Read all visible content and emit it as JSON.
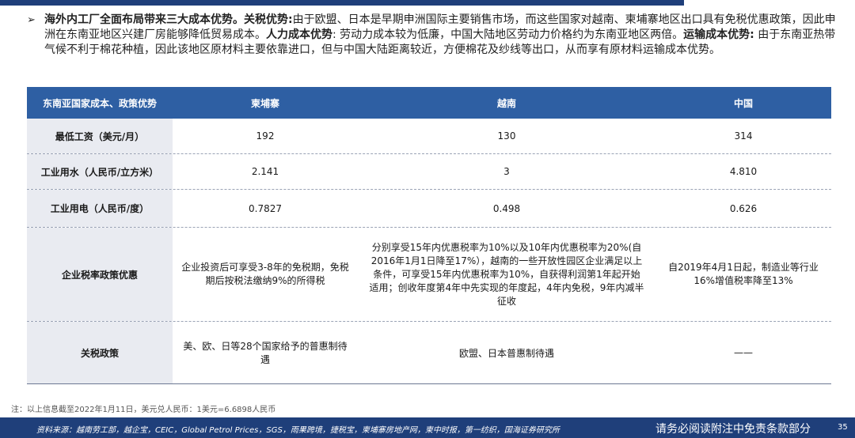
{
  "intro": {
    "bullet": "➢",
    "segments": [
      {
        "text": "海外内工厂全面布局带来三大成本优势。关税优势:",
        "bold": true
      },
      {
        "text": "由于欧盟、日本是早期申洲国际主要销售市场，而这些国家对越南、柬埔寨地区出口具有免税优惠政策，因此申洲在东南亚地区兴建厂房能够降低贸易成本。",
        "bold": false
      },
      {
        "text": "人力成本优势",
        "bold": true
      },
      {
        "text": ": 劳动力成本较为低廉，中国大陆地区劳动力价格约为东南亚地区两倍。",
        "bold": false
      },
      {
        "text": "运输成本优势:",
        "bold": true
      },
      {
        "text": " 由于东南亚热带气候不利于棉花种植，因此该地区原材料主要依靠进口，但与中国大陆距离较近，方便棉花及纱线等出口，从而享有原材料运输成本优势。",
        "bold": false
      }
    ]
  },
  "table": {
    "headers": [
      "东南亚国家成本、政策优势",
      "柬埔寨",
      "越南",
      "中国"
    ],
    "rows": [
      {
        "label": "最低工资（美元/月）",
        "cells": [
          "192",
          "130",
          "314"
        ]
      },
      {
        "label": "工业用水（人民币/立方米）",
        "cells": [
          "2.141",
          "3",
          "4.810"
        ]
      },
      {
        "label": "工业用电（人民币/度）",
        "cells": [
          "0.7827",
          "0.498",
          "0.626"
        ]
      },
      {
        "label": "企业税率政策优惠",
        "cells": [
          "企业投资后可享受3-8年的免税期，免税期后按税法缴纳9%的所得税",
          "分别享受15年内优惠税率为10%以及10年内优惠税率为20%(自2016年1月1日降至17%），越南的一些开放性园区企业满足以上条件，可享受15年内优惠税率为10%，自获得利润第1年起开始适用；创收年度第4年中先实现的年度起，4年内免税，9年内减半征收",
          "自2019年4月1日起，制造业等行业16%增值税率降至13%"
        ]
      },
      {
        "label": "关税政策",
        "cells": [
          "美、欧、日等28个国家给予的普惠制待遇",
          "欧盟、日本普惠制待遇",
          "——"
        ]
      }
    ]
  },
  "note": "注：以上信息截至2022年1月11日，美元兑人民币：1美元=6.6898人民币",
  "footer": {
    "source": "资料来源：越南劳工部，越企宝，CEIC，Global Petrol Prices，SGS，雨果跨境，捷税宝，柬埔寨房地产网，柬中时报，第一纺织，国海证券研究所",
    "disclaimer": "请务必阅读附注中免责条款部分",
    "page": "35"
  }
}
